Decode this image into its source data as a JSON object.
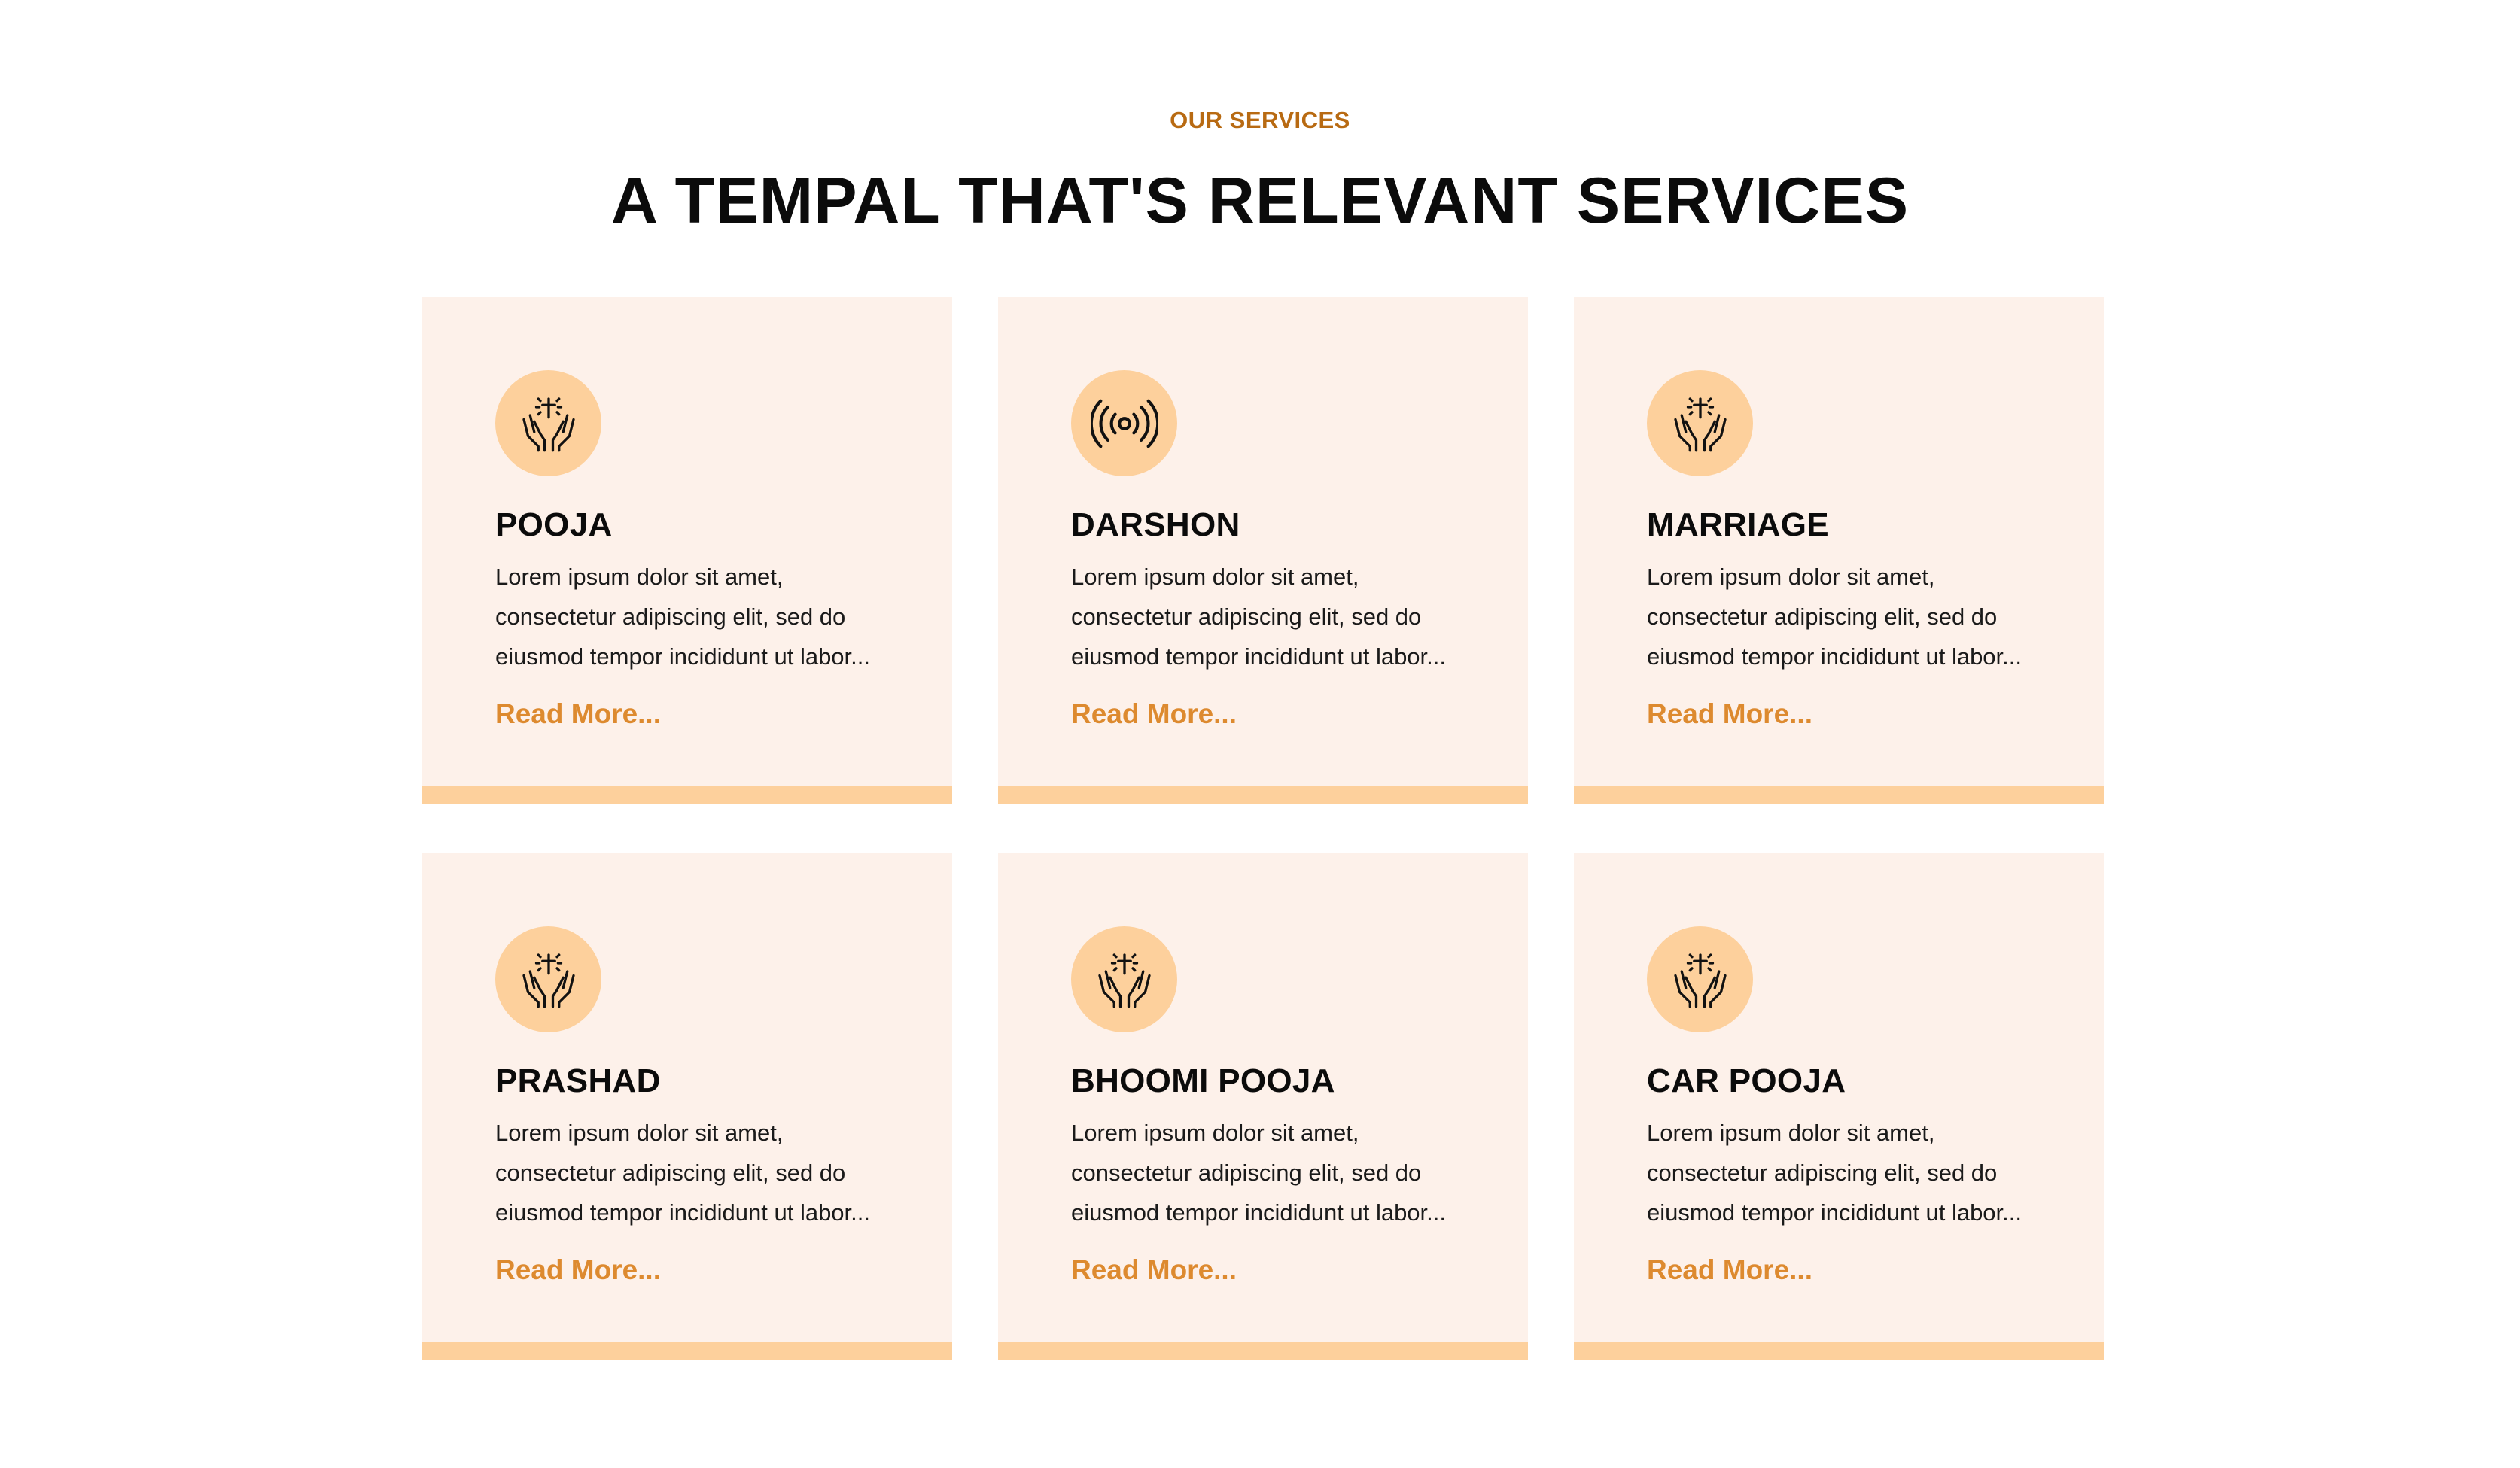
{
  "section": {
    "eyebrow": "OUR SERVICES",
    "heading": "A TEMPAL THAT'S RELEVANT SERVICES"
  },
  "colors": {
    "accent": "#b86a12",
    "link": "#dd8a2f",
    "card_bg": "#fdf1ea",
    "icon_bg": "#fdd09c"
  },
  "cards": [
    {
      "icon": "praying-hands-cross-icon",
      "title": "POOJA",
      "text": "Lorem ipsum dolor sit amet, consectetur adipiscing elit, sed do eiusmod tempor incididunt ut labor...",
      "link": "Read More..."
    },
    {
      "icon": "broadcast-signal-icon",
      "title": "DARSHON",
      "text": "Lorem ipsum dolor sit amet, consectetur adipiscing elit, sed do eiusmod tempor incididunt ut labor...",
      "link": "Read More..."
    },
    {
      "icon": "praying-hands-cross-icon",
      "title": "MARRIAGE",
      "text": "Lorem ipsum dolor sit amet, consectetur adipiscing elit, sed do eiusmod tempor incididunt ut labor...",
      "link": "Read More..."
    },
    {
      "icon": "praying-hands-cross-icon",
      "title": "PRASHAD",
      "text": "Lorem ipsum dolor sit amet, consectetur adipiscing elit, sed do eiusmod tempor incididunt ut labor...",
      "link": "Read More..."
    },
    {
      "icon": "praying-hands-cross-icon",
      "title": "BHOOMI POOJA",
      "text": "Lorem ipsum dolor sit amet, consectetur adipiscing elit, sed do eiusmod tempor incididunt ut labor...",
      "link": "Read More..."
    },
    {
      "icon": "praying-hands-cross-icon",
      "title": "CAR POOJA",
      "text": "Lorem ipsum dolor sit amet, consectetur adipiscing elit, sed do eiusmod tempor incididunt ut labor...",
      "link": "Read More..."
    }
  ]
}
